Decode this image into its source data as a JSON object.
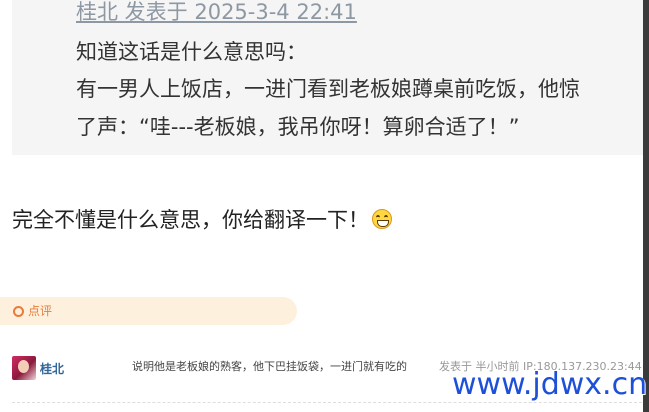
{
  "quote": {
    "author_line": "桂北 发表于 2025-3-4 22:41",
    "lines": [
      "知道这话是什么意思吗：",
      "有一男人上饭店，一进门看到老板娘蹲桌前吃饭，他惊",
      "了声：“哇---老板娘，我吊你呀！算卵合适了！”"
    ]
  },
  "post": {
    "text": "完全不懂是什么意思，你给翻译一下！",
    "emoji": "grin-emoji"
  },
  "comment_section": {
    "label": "点评"
  },
  "reply": {
    "user": "桂北",
    "text": "说明他是老板娘的熟客，他下巴挂饭袋，一进门就有吃的",
    "meta": "发表于 半小时前 IP:180.137.230.23:44"
  },
  "watermark": "www.jdwx.cn",
  "colors": {
    "quote_bg": "#f5f5f5",
    "link": "#336699",
    "accent_orange": "#e77b3c",
    "comment_bar_bg": "#fdf1dd",
    "watermark": "#1d4fd8"
  }
}
